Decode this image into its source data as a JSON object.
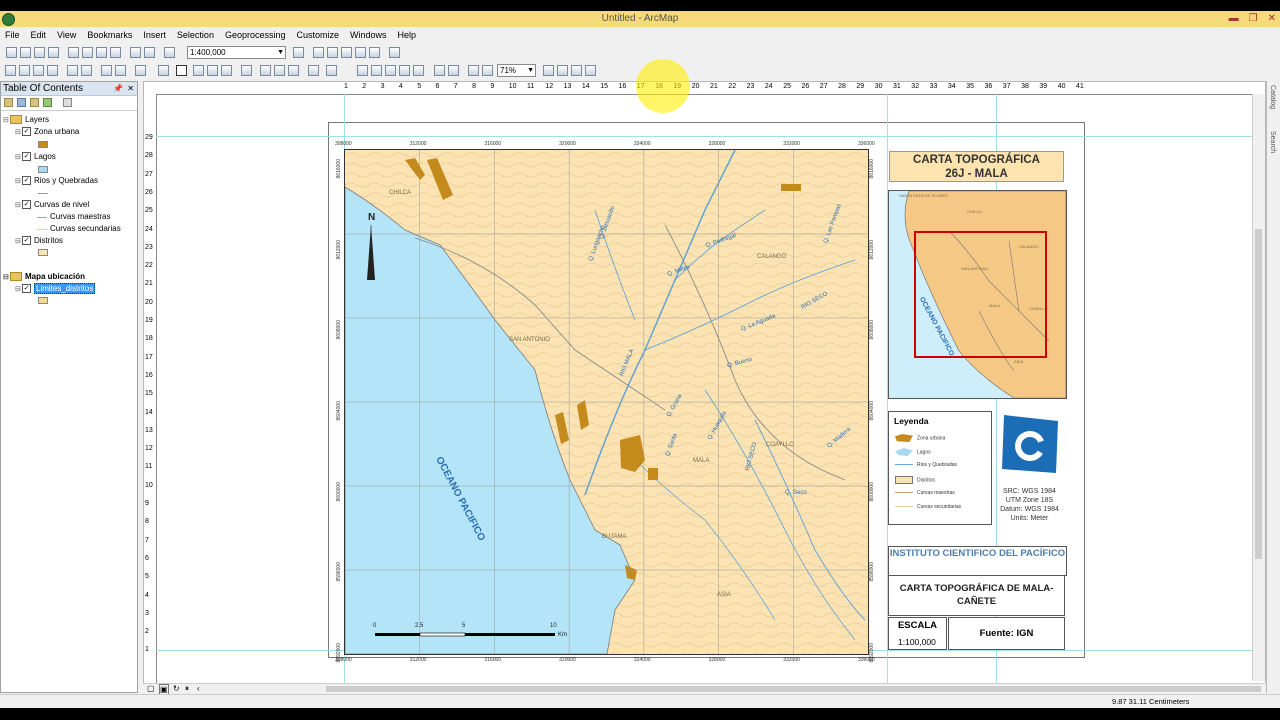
{
  "window": {
    "title": "Untitled - ArcMap"
  },
  "menu": [
    "File",
    "Edit",
    "View",
    "Bookmarks",
    "Insert",
    "Selection",
    "Geoprocessing",
    "Customize",
    "Windows",
    "Help"
  ],
  "toolbar": {
    "scale": "1:400,000",
    "zoom": "71%"
  },
  "toc": {
    "title": "Table Of Contents",
    "frames": [
      {
        "name": "Layers",
        "layers": [
          {
            "name": "Zona urbana",
            "sym": "fill",
            "color": "#c58a1c"
          },
          {
            "name": "Lagos",
            "sym": "fill",
            "color": "#a9d8f2"
          },
          {
            "name": "Rios y Quebradas",
            "sym": "line",
            "color": "#6aa7d6"
          },
          {
            "name": "Curvas de nivel",
            "sym": "classes",
            "classes": [
              "Curvas maestras",
              "Curvas secundarias"
            ]
          },
          {
            "name": "Distritos",
            "sym": "fill",
            "color": "#f9e3b0"
          }
        ]
      },
      {
        "name": "Mapa ubicación",
        "layers": [
          {
            "name": "Limites_distritos",
            "sym": "fill",
            "color": "#f4d89b",
            "selected": true
          }
        ]
      }
    ]
  },
  "ruler": {
    "h": [
      "1",
      "2",
      "3",
      "4",
      "5",
      "6",
      "7",
      "8",
      "9",
      "10",
      "11",
      "12",
      "13",
      "14",
      "15",
      "16",
      "17",
      "18",
      "19",
      "20",
      "21",
      "22",
      "23",
      "24",
      "25",
      "26",
      "27",
      "28",
      "29",
      "30",
      "31",
      "32",
      "33",
      "34",
      "35",
      "36",
      "37",
      "38",
      "39",
      "40",
      "41"
    ],
    "v": [
      "29",
      "28",
      "27",
      "26",
      "25",
      "24",
      "23",
      "22",
      "21",
      "20",
      "19",
      "18",
      "17",
      "16",
      "15",
      "14",
      "13",
      "12",
      "11",
      "10",
      "9",
      "8",
      "7",
      "6",
      "5",
      "4",
      "3",
      "2",
      "1"
    ]
  },
  "map": {
    "x_coords": [
      "308000",
      "312000",
      "316000",
      "320000",
      "324000",
      "328000",
      "332000",
      "336000"
    ],
    "y_coords": [
      "8616000",
      "8612000",
      "8608000",
      "8604000",
      "8600000",
      "8596000",
      "8592000"
    ],
    "places": [
      "CHILCA",
      "CALANGO",
      "SAN ANTONIO",
      "MALA",
      "COAYLLO",
      "BUJAMA",
      "ASIA"
    ],
    "ocean": "OCEANO PACIFICO",
    "rivers": [
      "Q. Lurigancho",
      "Q. Jahuacillo",
      "Q. Pedregal",
      "Q. Las Pampas",
      "Q. Milleo",
      "Q. La Aguada",
      "RIO SECO",
      "RIO MALA",
      "Q. Bueno",
      "Q. Grana",
      "Q. Santa",
      "Q. Huaquila",
      "Q. Madera",
      "RIO SECO",
      "Q. Seco"
    ],
    "north": "N",
    "scale_labels": [
      "0",
      "2.5",
      "5",
      "10"
    ],
    "scale_unit": "Km"
  },
  "title_block": {
    "line1": "CARTA TOPOGRÁFICA",
    "line2": "26J - MALA"
  },
  "inset": {
    "ocean": "OCEANO PACIFICO",
    "labels": [
      "SANTA CRUZ DE FLORES",
      "CHILCA",
      "CALANGO",
      "SAN ANTONIO",
      "MALA",
      "COAYLLO",
      "ASIA"
    ]
  },
  "legend": {
    "title": "Leyenda",
    "items": [
      "Zona urbana",
      "Lagos",
      "Rios y Quebradas",
      "Distritos",
      "Curvas maestras",
      "Curvas secundarias"
    ]
  },
  "src": {
    "l1": "SRC: WGS 1984",
    "l2": "UTM Zone 18S",
    "l3": "Datum: WGS 1984",
    "l4": "Units: Meter"
  },
  "institute": "INSTITUTO CIENTIFICO DEL PACÍFICO",
  "map_title": "CARTA TOPOGRÁFICA DE MALA-CAÑETE",
  "escala": {
    "label": "ESCALA",
    "value": "1:100,000"
  },
  "fuente": "Fuente: IGN",
  "right_tabs": [
    "Catalog",
    "Search"
  ],
  "status": {
    "coords": "9.87  31.11 Centimeters"
  }
}
